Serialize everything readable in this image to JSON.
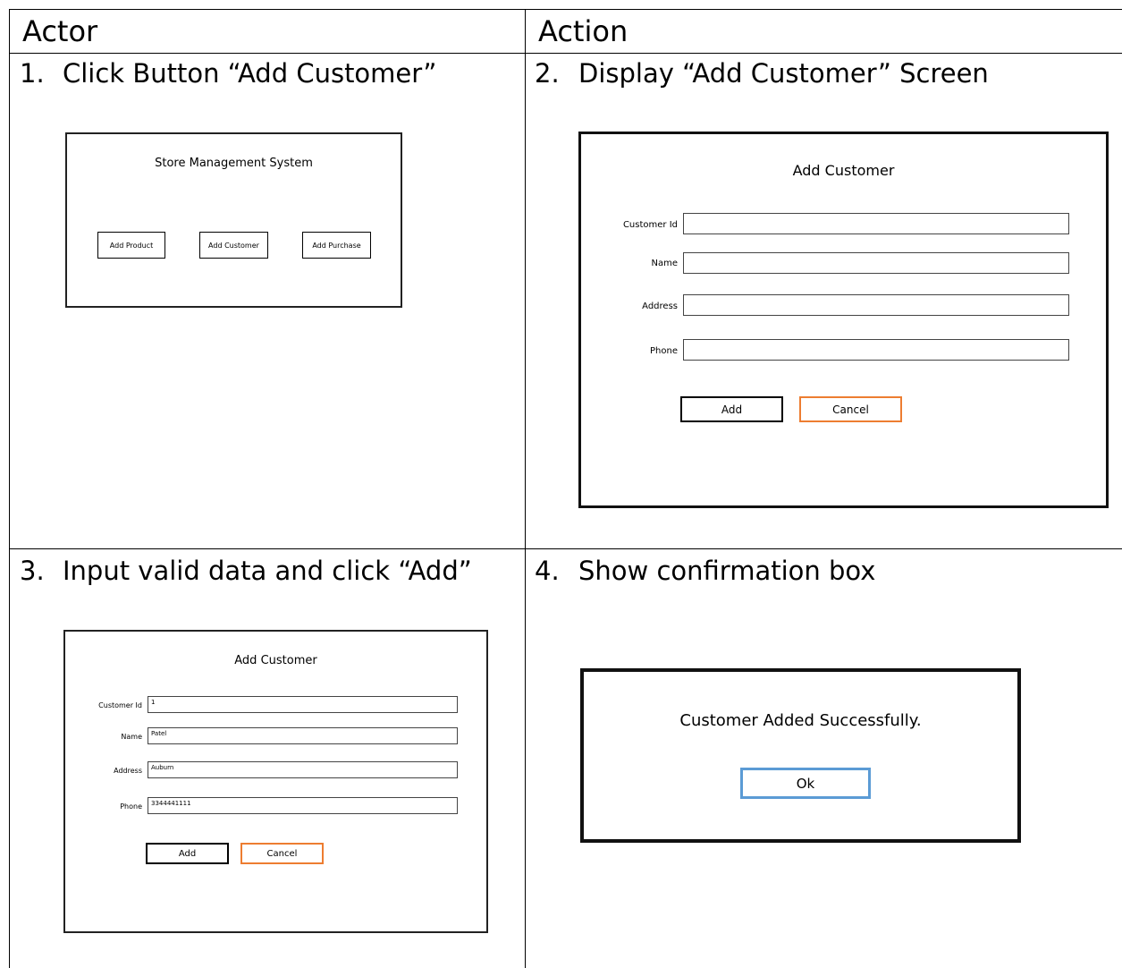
{
  "table": {
    "headers": {
      "actor": "Actor",
      "action": "Action"
    },
    "steps": [
      {
        "num": "1.",
        "text": "Click Button “Add Customer”"
      },
      {
        "num": "2.",
        "text": "Display “Add Customer” Screen"
      },
      {
        "num": "3.",
        "text": "Input valid data and click “Add”"
      },
      {
        "num": "4.",
        "text": "Show confirmation box"
      }
    ]
  },
  "mock_main": {
    "title": "Store Management System",
    "buttons": [
      "Add Product",
      "Add Customer",
      "Add Purchase"
    ]
  },
  "mock_form_empty": {
    "title": "Add Customer",
    "fields": [
      {
        "label": "Customer Id",
        "value": ""
      },
      {
        "label": "Name",
        "value": ""
      },
      {
        "label": "Address",
        "value": ""
      },
      {
        "label": "Phone",
        "value": ""
      }
    ],
    "add_label": "Add",
    "cancel_label": "Cancel"
  },
  "mock_form_filled": {
    "title": "Add Customer",
    "fields": [
      {
        "label": "Customer Id",
        "value": "1"
      },
      {
        "label": "Name",
        "value": "Patel"
      },
      {
        "label": "Address",
        "value": "Auburn"
      },
      {
        "label": "Phone",
        "value": "3344441111"
      }
    ],
    "add_label": "Add",
    "cancel_label": "Cancel"
  },
  "mock_confirm": {
    "message": "Customer Added Successfully.",
    "ok_label": "Ok"
  },
  "colors": {
    "cancel_border": "#ED7D31",
    "ok_border": "#5B9BD5"
  }
}
